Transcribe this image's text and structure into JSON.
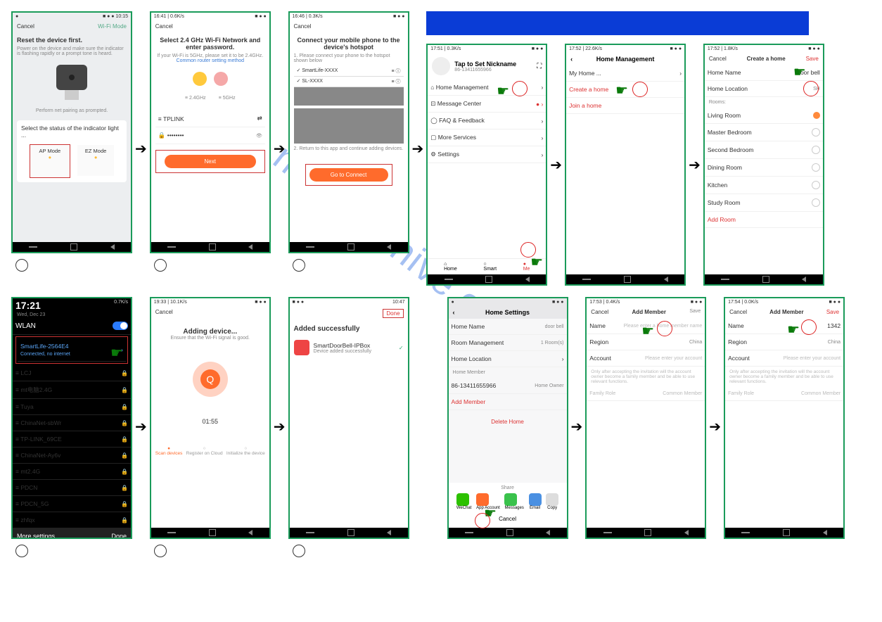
{
  "watermark": "manualshive.com",
  "row1": {
    "s1": {
      "cancel": "Cancel",
      "mode": "Wi-Fi Mode",
      "h": "Reset the device first.",
      "p": "Power on the device and make sure the indicator is flashing rapidly or a prompt tone is heard.",
      "tip": "Perform net pairing as prompted.",
      "sel": "Select the status of the indicator light ...",
      "ap": "AP Mode",
      "ez": "EZ Mode"
    },
    "s2": {
      "status": "16:41 | 0.6K/s",
      "cancel": "Cancel",
      "h": "Select 2.4 GHz Wi-Fi Network and enter password.",
      "sub": "If your Wi-Fi is 5GHz, please set it to be 2.4GHz.",
      "link": "Common router setting method",
      "g24": "2.4GHz",
      "g5": "5GHz",
      "ssid": "TPLINK",
      "pass": "••••••••",
      "next": "Next"
    },
    "s3": {
      "status": "16:46 | 0.3K/s",
      "cancel": "Cancel",
      "h": "Connect your mobile phone to the device's hotspot",
      "step1": "1. Please connect your phone to the hotspot shown below",
      "w1": "SmartLife-XXXX",
      "w2": "SL-XXXX",
      "step2": "2. Return to this app and continue adding devices.",
      "go": "Go to Connect"
    }
  },
  "row1r": {
    "s4": {
      "status": "17:51 | 0.3K/s",
      "nick": "Tap to Set Nickname",
      "id": "86-13411655966",
      "items": [
        "Home Management",
        "Message Center",
        "FAQ & Feedback",
        "More Services",
        "Settings"
      ],
      "tabs": [
        "Home",
        "Smart",
        "Me"
      ]
    },
    "s5": {
      "status": "17:52 | 22.6K/s",
      "title": "Home Management",
      "my": "My Home ...",
      "create": "Create a home",
      "join": "Join a home"
    },
    "s6": {
      "status": "17:52 | 1.8K/s",
      "cancel": "Cancel",
      "title": "Create a home",
      "save": "Save",
      "name_l": "Home Name",
      "name_v": "door bell",
      "loc_l": "Home Location",
      "loc_v": "SH",
      "rooms_l": "Rooms:",
      "rooms": [
        "Living Room",
        "Master Bedroom",
        "Second Bedroom",
        "Dining Room",
        "Kitchen",
        "Study Room"
      ],
      "add": "Add Room"
    }
  },
  "row2": {
    "s7": {
      "time": "17:21",
      "date": "Wed, Dec 23",
      "rate": "0.7K/s",
      "wlan": "WLAN",
      "sl": "SmartLife-2564E4",
      "slc": "Connected, no internet",
      "nets": [
        "LCJ",
        "mt电脑2.4G",
        "Tuya",
        "ChinaNet-sbWr",
        "TP-LINK_69CE",
        "ChinaNet-Ay6v",
        "mt2.4G",
        "PDCN",
        "PDCN_5G",
        "zhfqx"
      ],
      "more": "More settings",
      "done": "Done"
    },
    "s8": {
      "status": "19:33 | 10.1K/s",
      "cancel": "Cancel",
      "h": "Adding device...",
      "sub": "Ensure that the Wi-Fi signal is good.",
      "time": "01:55",
      "steps": [
        "Scan devices",
        "Register on Cloud",
        "Initialize the device"
      ]
    },
    "s9": {
      "status": "10:47",
      "done": "Done",
      "h": "Added successfully",
      "dev": "SmartDoorBell-IPBox",
      "devs": "Device added successfully"
    }
  },
  "row2r": {
    "s10": {
      "title": "Home Settings",
      "hn_l": "Home Name",
      "hn_v": "door bell",
      "rm": "Room Management",
      "rm_v": "1 Room(s)",
      "hl": "Home Location",
      "hm": "Home Member",
      "owner": "86-13411655966",
      "owner_r": "Home Owner",
      "add": "Add Member",
      "del": "Delete Home",
      "share": "Share",
      "shares": [
        "WeChat",
        "App Account",
        "Messages",
        "Email",
        "Copy"
      ],
      "cancel": "Cancel"
    },
    "s11": {
      "status": "17:53 | 0.4K/s",
      "cancel": "Cancel",
      "title": "Add Member",
      "save": "Save",
      "name_l": "Name",
      "name_p": "Please enter a home member name",
      "reg_l": "Region",
      "reg_v": "China",
      "acc_l": "Account",
      "acc_p": "Please enter your account",
      "note": "Only after accepting the invitation will the account owner become a family member and be able to use relevant functions.",
      "role_l": "Family Role",
      "role_v": "Common Member"
    },
    "s12": {
      "status": "17:54 | 0.0K/s",
      "cancel": "Cancel",
      "title": "Add Member",
      "save": "Save",
      "name_l": "Name",
      "name_v": "1342",
      "reg_l": "Region",
      "reg_v": "China",
      "acc_l": "Account",
      "acc_p": "Please enter your account",
      "note": "Only after accepting the invitation will the account owner become a family member and be able to use relevant functions.",
      "role_l": "Family Role",
      "role_v": "Common Member"
    }
  }
}
